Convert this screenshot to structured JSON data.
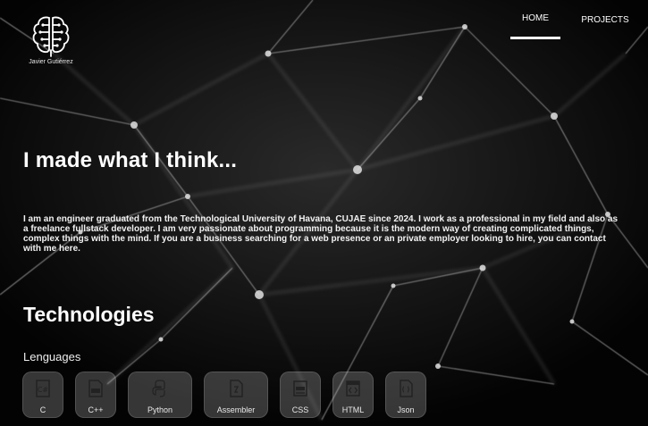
{
  "brand": {
    "name": "Javier Gutiérrez"
  },
  "nav": {
    "items": [
      {
        "label": "HOME",
        "active": true
      },
      {
        "label": "PROJECTS",
        "active": false
      }
    ]
  },
  "hero": {
    "title": "I made what I think...",
    "text": "I am an engineer graduated from the Technological University of Havana, CUJAE since 2024. I work as a professional in my field and also as a freelance fullstack developer. I am very passionate about programming because it is the modern way of creating complicated things, complex things with the mind. If you are a business searching for a web presence or an private employer looking to hire, you can contact with me here."
  },
  "technologies": {
    "title": "Technologies",
    "languages_title": "Lenguages",
    "languages": [
      {
        "label": "C",
        "icon": "c-file-icon"
      },
      {
        "label": "C++",
        "icon": "cpp-file-icon"
      },
      {
        "label": "Python",
        "icon": "python-icon"
      },
      {
        "label": "Assembler",
        "icon": "asm-file-icon"
      },
      {
        "label": "CSS",
        "icon": "css-file-icon"
      },
      {
        "label": "HTML",
        "icon": "html-icon"
      },
      {
        "label": "Json",
        "icon": "json-file-icon"
      }
    ]
  },
  "colors": {
    "background": "#050505",
    "text": "#ffffff",
    "chip": "rgba(200,200,200,0.26)"
  }
}
